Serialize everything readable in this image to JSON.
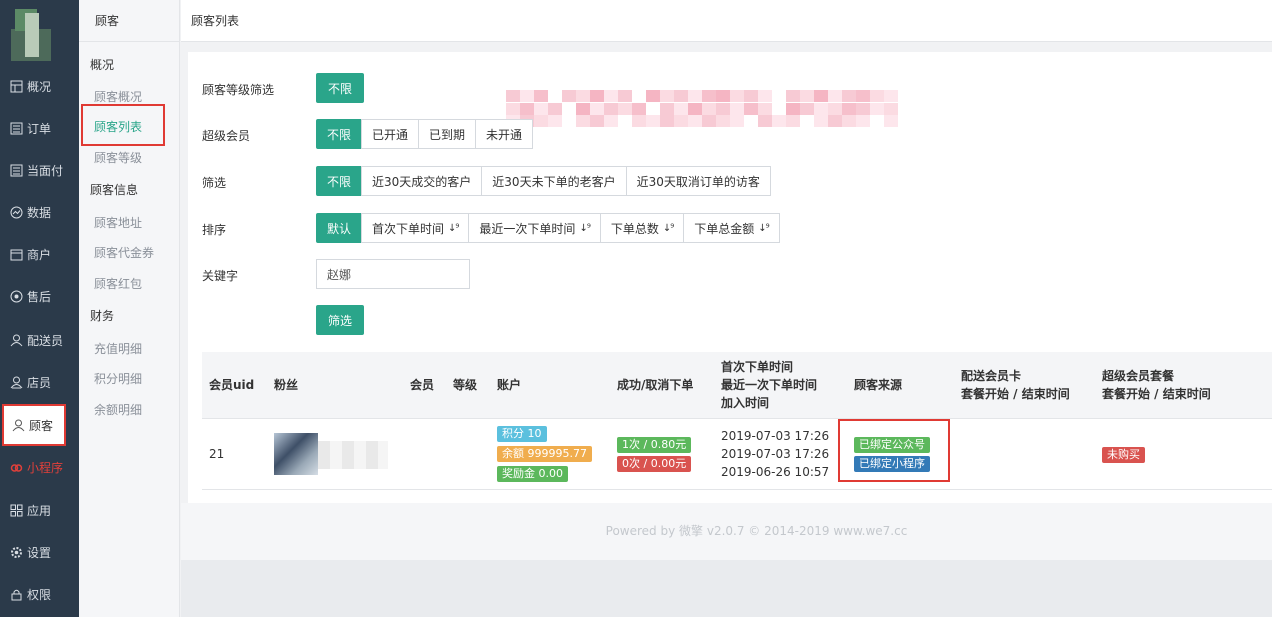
{
  "nav": {
    "items": [
      {
        "label": "概况",
        "icon": "overview-icon"
      },
      {
        "label": "订单",
        "icon": "order-icon"
      },
      {
        "label": "当面付",
        "icon": "face-pay-icon"
      },
      {
        "label": "数据",
        "icon": "data-icon"
      },
      {
        "label": "商户",
        "icon": "merchant-icon"
      },
      {
        "label": "售后",
        "icon": "aftersale-icon"
      },
      {
        "label": "配送员",
        "icon": "courier-icon"
      },
      {
        "label": "店员",
        "icon": "clerk-icon"
      },
      {
        "label": "顾客",
        "icon": "customer-icon"
      },
      {
        "label": "小程序",
        "icon": "miniprogram-icon"
      },
      {
        "label": "应用",
        "icon": "apps-icon"
      },
      {
        "label": "设置",
        "icon": "settings-icon"
      },
      {
        "label": "权限",
        "icon": "permission-icon"
      }
    ]
  },
  "subnav": {
    "title": "顾客",
    "groups": [
      {
        "label": "概况",
        "items": [
          "顾客概况",
          "顾客列表",
          "顾客等级"
        ]
      },
      {
        "label": "顾客信息",
        "items": [
          "顾客地址",
          "顾客代金券",
          "顾客红包"
        ]
      },
      {
        "label": "财务",
        "items": [
          "充值明细",
          "积分明细",
          "余额明细"
        ]
      }
    ]
  },
  "header": {
    "title": "顾客列表"
  },
  "filters": {
    "level_label": "顾客等级筛选",
    "level_btn": "不限",
    "super_label": "超级会员",
    "super_opts": [
      "不限",
      "已开通",
      "已到期",
      "未开通"
    ],
    "filter_label": "筛选",
    "filter_opts": [
      "不限",
      "近30天成交的客户",
      "近30天未下单的老客户",
      "近30天取消订单的访客"
    ],
    "sort_label": "排序",
    "sort_opts": [
      "默认",
      "首次下单时间",
      "最近一次下单时间",
      "下单总数",
      "下单总金额"
    ],
    "sort_icon": "↓⁹",
    "keyword_label": "关键字",
    "keyword_value": "赵娜",
    "submit": "筛选"
  },
  "table": {
    "headers": {
      "uid": "会员uid",
      "fans": "粉丝",
      "member": "会员",
      "level": "等级",
      "account": "账户",
      "orders": "成功/取消下单",
      "time1": "首次下单时间",
      "time2": "最近一次下单时间",
      "time3": "加入时间",
      "source": "顾客来源",
      "card1": "配送会员卡",
      "card2": "套餐开始 / 结束时间",
      "super1": "超级会员套餐",
      "super2": "套餐开始 / 结束时间"
    },
    "rows": [
      {
        "uid": "21",
        "points": "积分 10",
        "balance": "余额 999995.77",
        "bonus": "奖励金 0.00",
        "success": "1次 / 0.80元",
        "cancel": "0次 / 0.00元",
        "first_time": "2019-07-03 17:26",
        "last_time": "2019-07-03 17:26",
        "join_time": "2019-06-26 10:57",
        "source1": "已绑定公众号",
        "source2": "已绑定小程序",
        "super_status": "未购买"
      }
    ]
  },
  "footer": {
    "text": "Powered by 微擎 v2.0.7 © 2014-2019 www.we7.cc"
  },
  "colors": {
    "accent": "#2aa58a",
    "nav_bg": "#2b3a4a",
    "highlight_red": "#e03a34"
  }
}
